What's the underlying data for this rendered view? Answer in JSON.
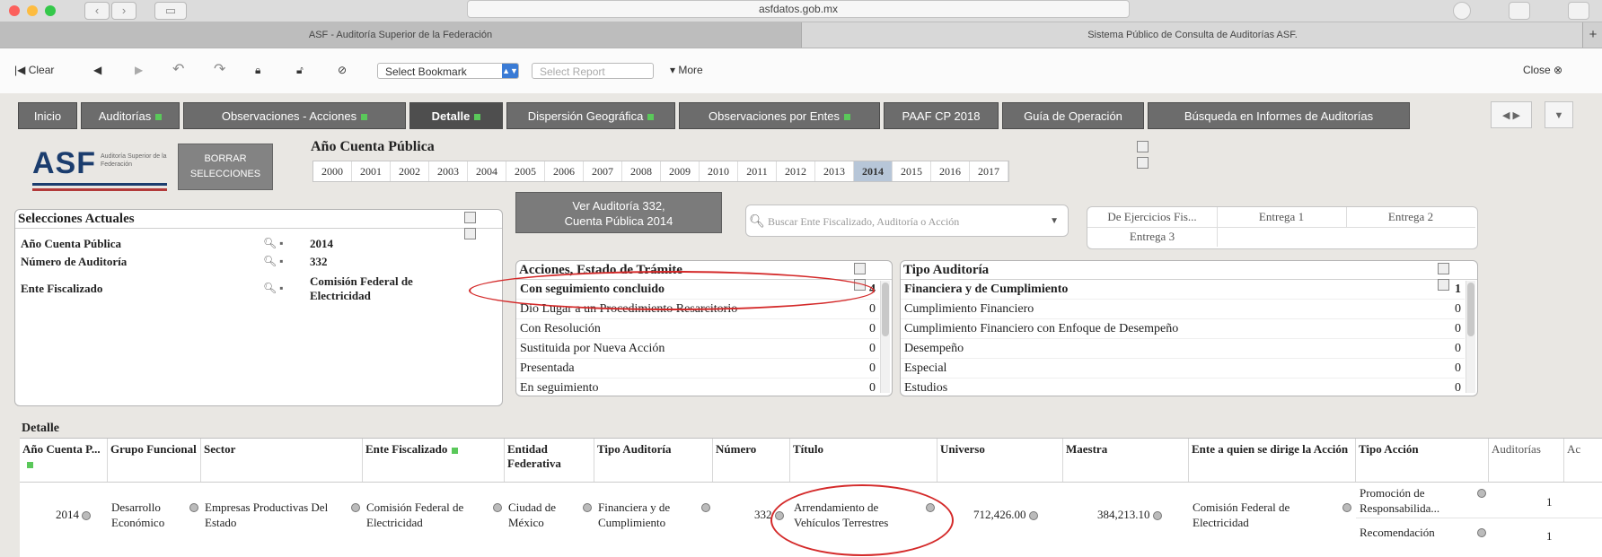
{
  "browser": {
    "url": "asfdatos.gob.mx",
    "tabs": [
      "ASF - Auditoría Superior de la Federación",
      "Sistema Público de Consulta de Auditorías ASF."
    ],
    "new_tab": "+"
  },
  "toolbar": {
    "clear": "Clear",
    "bookmark": "Select Bookmark",
    "report": "Select Report",
    "more": "▾ More",
    "close": "Close"
  },
  "apptabs": [
    "Inicio",
    "Auditorías",
    "Observaciones - Acciones",
    "Detalle",
    "Dispersión Geográfica",
    "Observaciones por Entes",
    "PAAF CP 2018",
    "Guía de Operación",
    "Búsqueda en Informes de Auditorías"
  ],
  "logo": {
    "text": "ASF",
    "sub": "Auditoría Superior de la Federación"
  },
  "borrar": [
    "BORRAR",
    "SELECCIONES"
  ],
  "year_panel": {
    "title": "Año Cuenta Pública",
    "years": [
      "2000",
      "2001",
      "2002",
      "2003",
      "2004",
      "2005",
      "2006",
      "2007",
      "2008",
      "2009",
      "2010",
      "2011",
      "2012",
      "2013",
      "2014",
      "2015",
      "2016",
      "2017"
    ],
    "selected": "2014"
  },
  "selecciones": {
    "title": "Selecciones Actuales",
    "rows": [
      {
        "label": "Año Cuenta Pública",
        "value": "2014"
      },
      {
        "label": "Número de Auditoría",
        "value": "332"
      },
      {
        "label": "Ente Fiscalizado",
        "value": "Comisión Federal de Electricidad"
      }
    ]
  },
  "ver_auditoria": [
    "Ver Auditoría 332,",
    "Cuenta Pública 2014"
  ],
  "search": {
    "placeholder": "Buscar Ente Fiscalizado, Auditoría o Acción"
  },
  "entrega": {
    "c1": "De Ejercicios Fis...",
    "c2": "Entrega 1",
    "c3": "Entrega 2",
    "c4": "Entrega 3"
  },
  "acciones": {
    "title": "Acciones, Estado de Trámite",
    "rows": [
      {
        "label": "Con seguimiento concluido",
        "count": "4"
      },
      {
        "label": "Dio Lugar a un Procedimiento Resarcitorio",
        "count": "0"
      },
      {
        "label": "Con Resolución",
        "count": "0"
      },
      {
        "label": "Sustituida por Nueva Acción",
        "count": "0"
      },
      {
        "label": "Presentada",
        "count": "0"
      },
      {
        "label": "En seguimiento",
        "count": "0"
      }
    ]
  },
  "tipo_auditoria": {
    "title": "Tipo Auditoría",
    "rows": [
      {
        "label": "Financiera y de Cumplimiento",
        "count": "1"
      },
      {
        "label": "Cumplimiento Financiero",
        "count": "0"
      },
      {
        "label": "Cumplimiento Financiero con Enfoque de Desempeño",
        "count": "0"
      },
      {
        "label": "Desempeño",
        "count": "0"
      },
      {
        "label": "Especial",
        "count": "0"
      },
      {
        "label": "Estudios",
        "count": "0"
      }
    ]
  },
  "detalle": {
    "title": "Detalle",
    "headers": [
      "Año Cuenta P...",
      "Grupo Funcional",
      "Sector",
      "Ente Fiscalizado",
      "Entidad Federativa",
      "Tipo Auditoría",
      "Número",
      "Título",
      "Universo",
      "Maestra",
      "Ente a quien se dirige la Acción",
      "Tipo Acción",
      "Auditorías",
      "Ac"
    ],
    "row": {
      "anio": "2014",
      "grupo": "Desarrollo Económico",
      "sector": "Empresas Productivas Del Estado",
      "ente": "Comisión Federal de Electricidad",
      "entidad": "Ciudad de México",
      "tipo": "Financiera y de Cumplimiento",
      "numero": "332",
      "titulo": "Arrendamiento de Vehículos Terrestres",
      "universo": "712,426.00",
      "muestra": "384,213.10",
      "ente_accion": "Comisión Federal de Electricidad",
      "tipo_accion_1": "Promoción de Responsabilida...",
      "tipo_accion_2": "Recomendación",
      "aud_1": "1",
      "aud_2": "1"
    }
  }
}
